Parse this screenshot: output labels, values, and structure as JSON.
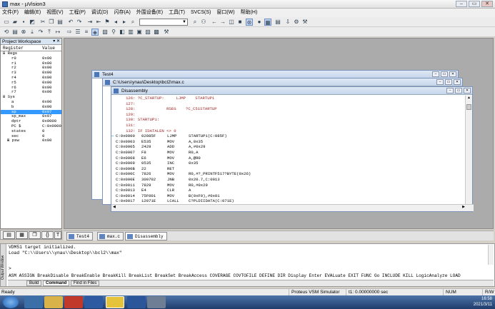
{
  "app": {
    "title": "max - µVision3",
    "min": "–",
    "max": "▭",
    "close": "✕"
  },
  "menu": [
    "文件(F)",
    "编辑(E)",
    "视图(V)",
    "工程(P)",
    "调试(D)",
    "闪存(A)",
    "外围设备(E)",
    "工具(T)",
    "SVCS(S)",
    "窗口(W)",
    "帮助(H)"
  ],
  "toolbar": {
    "combo_value": ""
  },
  "project_workspace": {
    "title": "Project Workspace",
    "controls": "▾ ✕",
    "headers": {
      "register": "Register",
      "value": "Value"
    },
    "rows": [
      {
        "indent": 0,
        "name": "⊟ Regs",
        "value": ""
      },
      {
        "indent": 2,
        "name": "r0",
        "value": "0x00"
      },
      {
        "indent": 2,
        "name": "r1",
        "value": "0x00"
      },
      {
        "indent": 2,
        "name": "r2",
        "value": "0x00"
      },
      {
        "indent": 2,
        "name": "r3",
        "value": "0x00"
      },
      {
        "indent": 2,
        "name": "r4",
        "value": "0x00"
      },
      {
        "indent": 2,
        "name": "r5",
        "value": "0x00"
      },
      {
        "indent": 2,
        "name": "r6",
        "value": "0x00"
      },
      {
        "indent": 2,
        "name": "r7",
        "value": "0x00"
      },
      {
        "indent": 0,
        "name": "⊟ Sys",
        "value": ""
      },
      {
        "indent": 2,
        "name": "a",
        "value": "0x00"
      },
      {
        "indent": 2,
        "name": "b",
        "value": "0x00"
      },
      {
        "indent": 2,
        "name": "sp",
        "value": "0x07",
        "selected": true
      },
      {
        "indent": 2,
        "name": "sp_max",
        "value": "0x07"
      },
      {
        "indent": 2,
        "name": "dptr",
        "value": "0x0000"
      },
      {
        "indent": 2,
        "name": "PC  $",
        "value": "C:0x0000"
      },
      {
        "indent": 2,
        "name": "states",
        "value": "0"
      },
      {
        "indent": 2,
        "name": "sec",
        "value": "0"
      },
      {
        "indent": 1,
        "name": "⊞ psw",
        "value": "0x00"
      }
    ]
  },
  "windows": {
    "test4": {
      "title": "Test4"
    },
    "max_c": {
      "title": "C:\\Users\\ynau\\Desktop\\bcl2\\max.c"
    },
    "disasm": {
      "title": "Disassembly"
    }
  },
  "disassembly": [
    {
      "kind": "src",
      "text": "   126: ?C_STARTUP:     LJMP    STARTUP1"
    },
    {
      "kind": "src",
      "text": "   127:"
    },
    {
      "kind": "src",
      "text": "   128:             RSEG    ?C_C51STARTUP"
    },
    {
      "kind": "src",
      "text": "   129:"
    },
    {
      "kind": "src",
      "text": "   130: STARTUP1:"
    },
    {
      "kind": "src",
      "text": "   131:"
    },
    {
      "kind": "src",
      "text": "   132: IF IDATALEN <> 0"
    },
    {
      "kind": "asm",
      "addr": "C:0x0000",
      "code": "02085F",
      "op": "LJMP",
      "arg": "STARTUP1(C:085F)",
      "current": true
    },
    {
      "kind": "asm",
      "addr": "C:0x0003",
      "code": "E535",
      "op": "MOV",
      "arg": "A,0x35"
    },
    {
      "kind": "asm",
      "addr": "C:0x0005",
      "code": "2429",
      "op": "ADD",
      "arg": "A,#0x29"
    },
    {
      "kind": "asm",
      "addr": "C:0x0007",
      "code": "F8",
      "op": "MOV",
      "arg": "R0,A"
    },
    {
      "kind": "asm",
      "addr": "C:0x0008",
      "code": "E6",
      "op": "MOV",
      "arg": "A,@R0"
    },
    {
      "kind": "asm",
      "addr": "C:0x0009",
      "code": "0535",
      "op": "INC",
      "arg": "0x35"
    },
    {
      "kind": "asm",
      "addr": "C:0x000B",
      "code": "22",
      "op": "RET",
      "arg": ""
    },
    {
      "kind": "asm",
      "addr": "C:0x000C",
      "code": "7826",
      "op": "MOV",
      "arg": "R0,#?_PRINTF517?BYTE(0x26)"
    },
    {
      "kind": "asm",
      "addr": "C:0x000E",
      "code": "300702",
      "op": "JNB",
      "arg": "0x20.7,C:0013"
    },
    {
      "kind": "asm",
      "addr": "C:0x0011",
      "code": "7829",
      "op": "MOV",
      "arg": "R0,#0x29"
    },
    {
      "kind": "asm",
      "addr": "C:0x0013",
      "code": "E4",
      "op": "CLR",
      "arg": "A"
    },
    {
      "kind": "asm",
      "addr": "C:0x0014",
      "code": "75F001",
      "op": "MOV",
      "arg": "B(0xF0),#0x01"
    },
    {
      "kind": "asm",
      "addr": "C:0x0017",
      "code": "12071E",
      "op": "LCALL",
      "arg": "C?PLDIIDATA(C:071E)"
    }
  ],
  "doc_tabs": [
    {
      "label": "Test4"
    },
    {
      "label": "max.c"
    },
    {
      "label": "Disassembly",
      "active": true
    }
  ],
  "output": {
    "lines": [
      "VDM51 target initialized.",
      "Load \"C:\\\\Users\\\\ynau\\\\Desktop\\\\bcl2\\\\max\""
    ],
    "prompt": ">",
    "commands": "ASM ASSIGN BreakDisable BreakEnable BreakKill BreakList BreakSet BreakAccess COVERAGE COVTOFILE DEFINE DIR Display Enter EVALuate EXIT FUNC Go INCLUDE KILL LogicAnalyze LOAD",
    "tabs": [
      "Build",
      "Command",
      "Find in Files"
    ],
    "side_label": "Output Window"
  },
  "status": {
    "ready": "Ready",
    "simulator": "Proteus VSM Simulator",
    "time": "t1: 0.00000000 sec",
    "num": "NUM",
    "rw": "R/W"
  },
  "taskbar": {
    "time": "16:58",
    "date": "2021/3/11"
  }
}
